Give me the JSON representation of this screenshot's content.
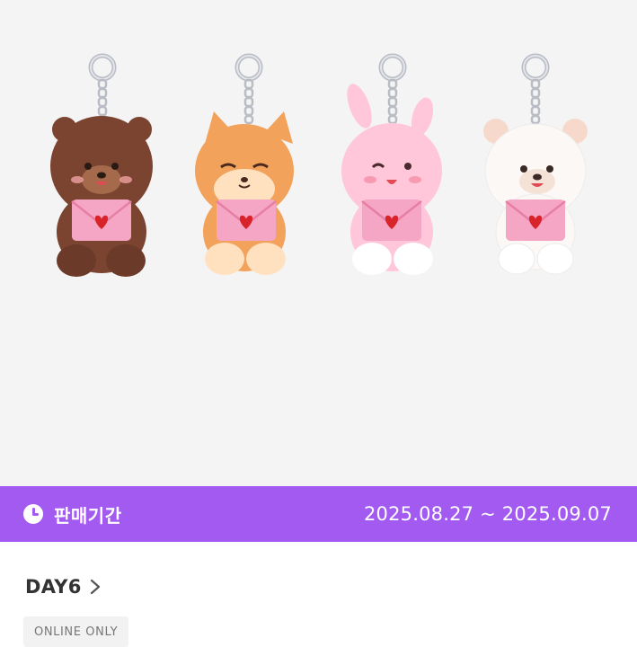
{
  "hero": {
    "characters": [
      {
        "icon": "bear-plush-keyring-icon",
        "body": "#7a4430",
        "light": "#a46a4b"
      },
      {
        "icon": "fox-plush-keyring-icon",
        "body": "#f2a25a",
        "light": "#ffe1c0"
      },
      {
        "icon": "rabbit-plush-keyring-icon",
        "body": "#ffc7d9",
        "light": "#ffffff"
      },
      {
        "icon": "polar-bear-plush-keyring-icon",
        "body": "#fbf8f6",
        "light": "#f7d9cc"
      }
    ],
    "envelope_color": "#f5a6c4",
    "heart_color": "#d8232a"
  },
  "sale_period": {
    "icon": "clock-icon",
    "label": "판매기간",
    "dates": "2025.08.27 ~ 2025.09.07",
    "bar_color": "#a35af0"
  },
  "product": {
    "artist": "DAY6",
    "artist_link_icon": "chevron-right-icon",
    "badge": "ONLINE ONLY"
  }
}
